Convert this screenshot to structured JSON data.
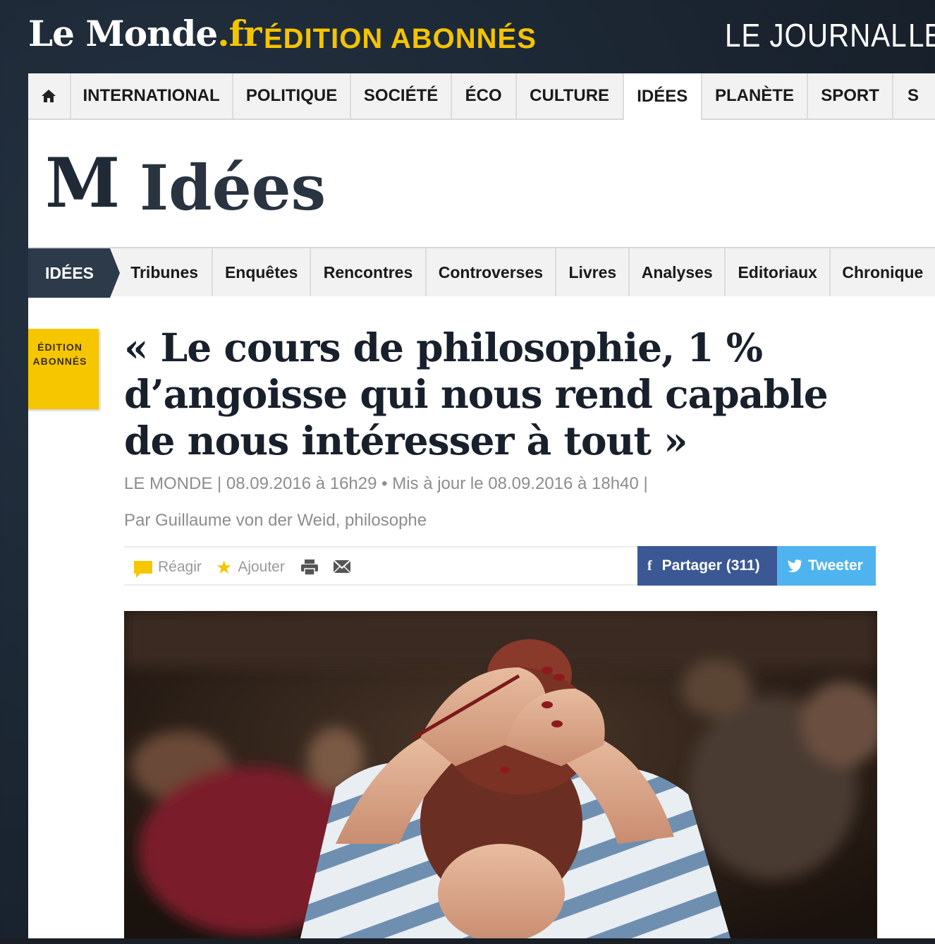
{
  "header": {
    "logo_text": "Le Monde",
    "logo_suffix": ".fr",
    "edition": "ÉDITION ABONNÉS",
    "right_link": "LE JOURNAL",
    "right_link_cut": "LE"
  },
  "main_nav": {
    "items": [
      {
        "label": "INTERNATIONAL"
      },
      {
        "label": "POLITIQUE"
      },
      {
        "label": "SOCIÉTÉ"
      },
      {
        "label": "ÉCO"
      },
      {
        "label": "CULTURE"
      },
      {
        "label": "IDÉES",
        "active": true
      },
      {
        "label": "PLANÈTE"
      },
      {
        "label": "SPORT"
      },
      {
        "label": "S"
      }
    ]
  },
  "section": {
    "logo_mark": "M",
    "title": "Idées"
  },
  "sub_nav": {
    "active": "IDÉES",
    "items": [
      "Tribunes",
      "Enquêtes",
      "Rencontres",
      "Controverses",
      "Livres",
      "Analyses",
      "Editoriaux",
      "Chronique"
    ]
  },
  "badge": {
    "line1": "ÉDITION",
    "line2": "ABONNÉS"
  },
  "article": {
    "title": "« Le cours de philosophie, 1 % d’angoisse qui nous rend capable de nous intéresser à tout »",
    "meta": "LE MONDE | 08.09.2016 à 16h29 • Mis à jour le 08.09.2016 à 18h40 |",
    "author": "Par Guillaume von der Weid, philosophe"
  },
  "actions": {
    "react": "Réagir",
    "add": "Ajouter",
    "share": "Partager (311)",
    "tweet": "Tweeter"
  },
  "colors": {
    "brand_yellow": "#f6c600",
    "navy": "#2c3a4a",
    "facebook": "#3b5894",
    "twitter": "#4fb3ef"
  }
}
